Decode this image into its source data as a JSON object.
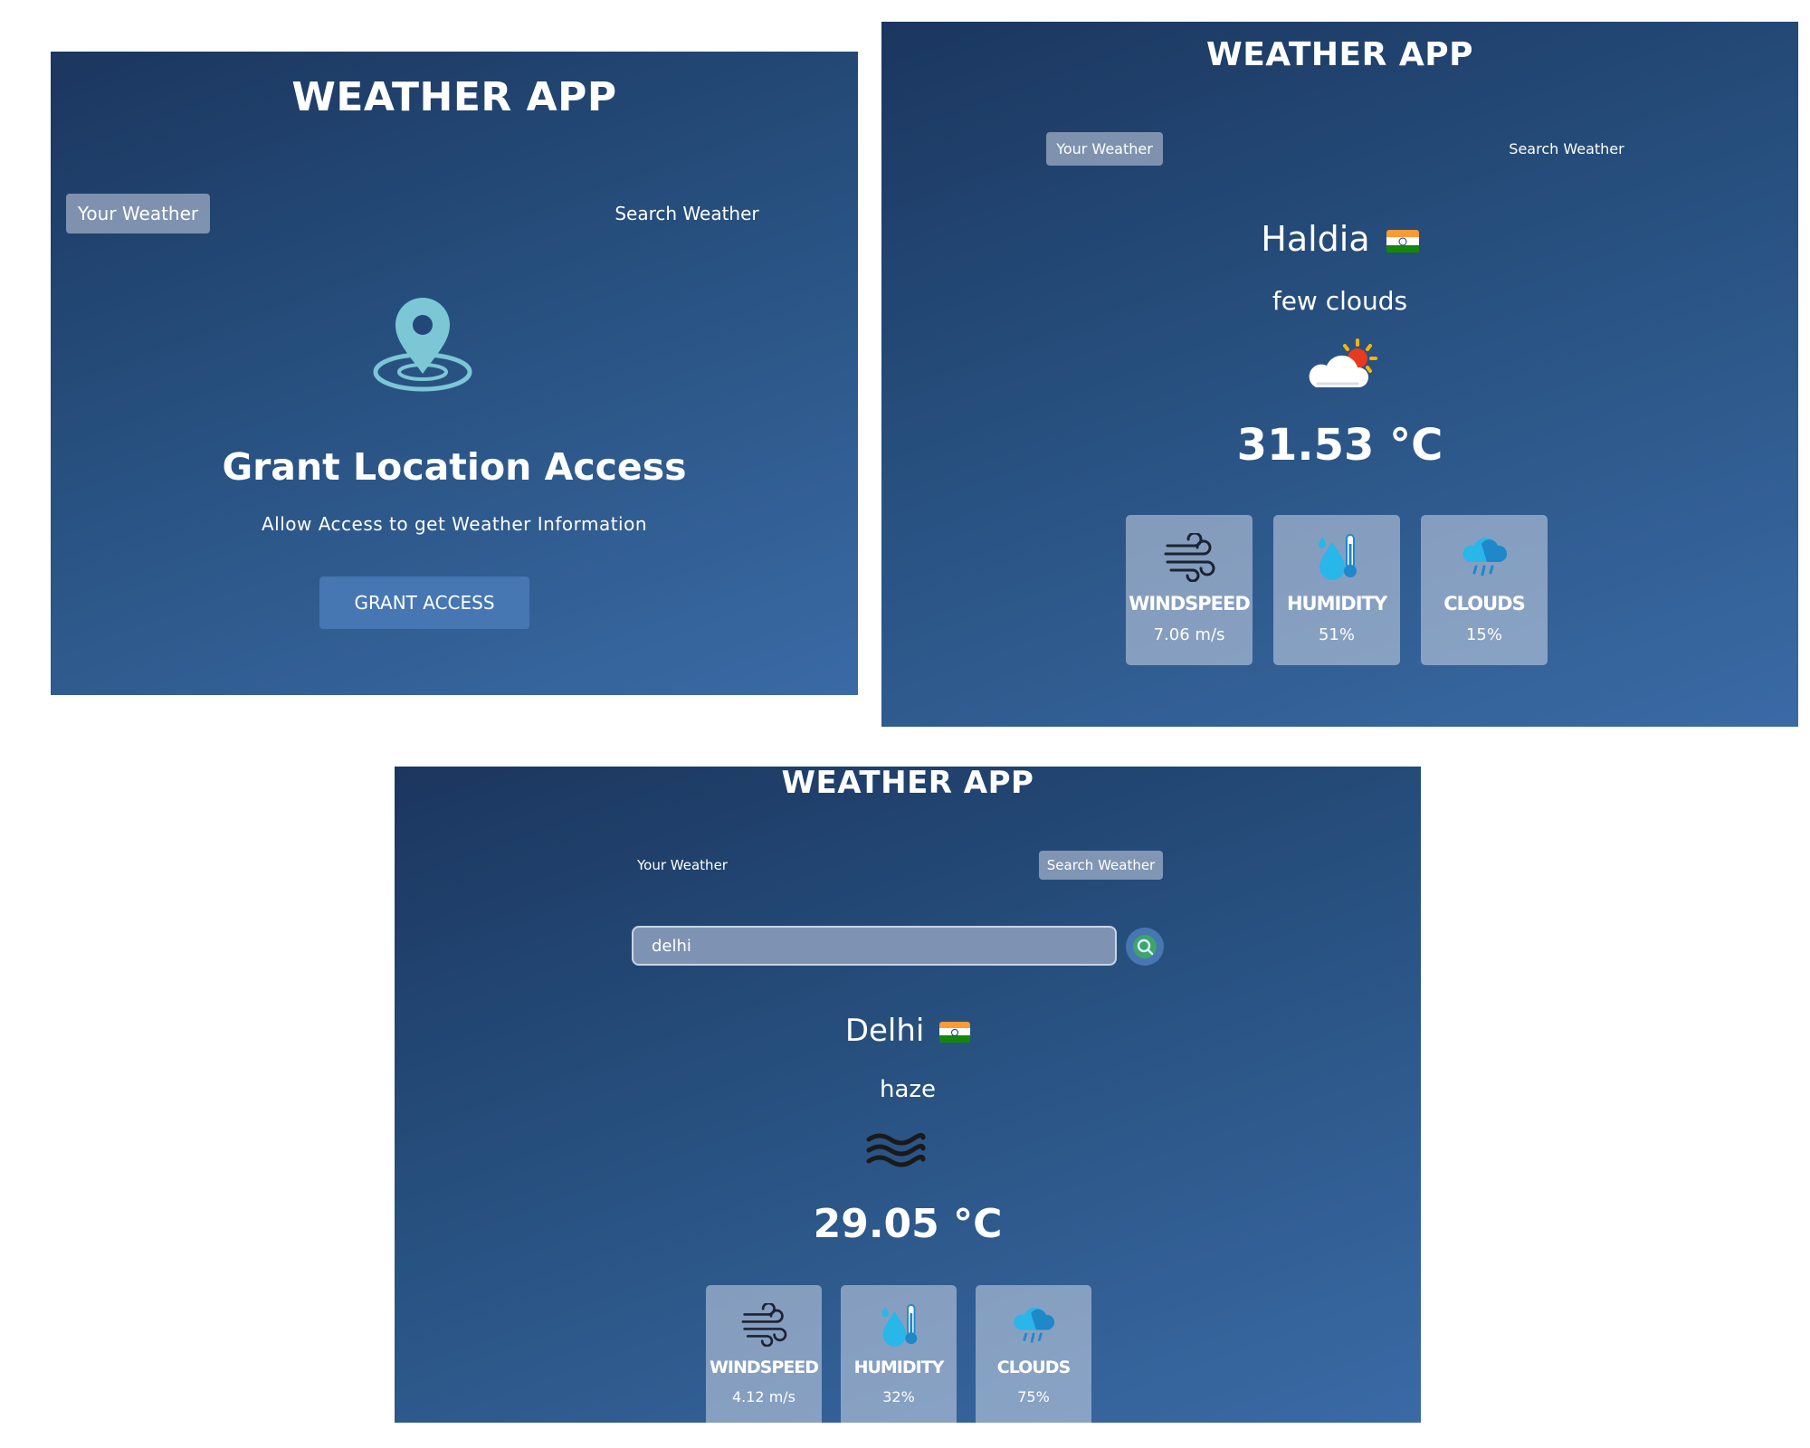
{
  "app_title": "WEATHER APP",
  "tabs": {
    "your_weather": "Your Weather",
    "search_weather": "Search Weather"
  },
  "grant_screen": {
    "heading": "Grant Location Access",
    "subtext": "Allow Access to get Weather Information",
    "button_label": "GRANT ACCESS",
    "icon": "location-pin-icon"
  },
  "haldia_screen": {
    "city": "Haldia",
    "flag": "india-flag-icon",
    "description": "few clouds",
    "weather_icon": "partly-cloudy-icon",
    "temperature": "31.53 °C",
    "cards": [
      {
        "label": "WINDSPEED",
        "value": "7.06 m/s",
        "icon": "wind-icon"
      },
      {
        "label": "HUMIDITY",
        "value": "51%",
        "icon": "humidity-icon"
      },
      {
        "label": "CLOUDS",
        "value": "15%",
        "icon": "rain-cloud-icon"
      }
    ]
  },
  "delhi_screen": {
    "search_value": "delhi",
    "city": "Delhi",
    "flag": "india-flag-icon",
    "description": "haze",
    "weather_icon": "haze-icon",
    "temperature": "29.05 °C",
    "cards": [
      {
        "label": "WINDSPEED",
        "value": "4.12 m/s",
        "icon": "wind-icon"
      },
      {
        "label": "HUMIDITY",
        "value": "32%",
        "icon": "humidity-icon"
      },
      {
        "label": "CLOUDS",
        "value": "75%",
        "icon": "rain-cloud-icon"
      }
    ]
  },
  "colors": {
    "panel_gradient_top": "#1b365f",
    "panel_gradient_bottom": "#3a6aa5",
    "card_bg": "rgba(219,226,239,0.5)",
    "button_bg": "#4677b3",
    "location_icon": "#7cc7d6"
  }
}
